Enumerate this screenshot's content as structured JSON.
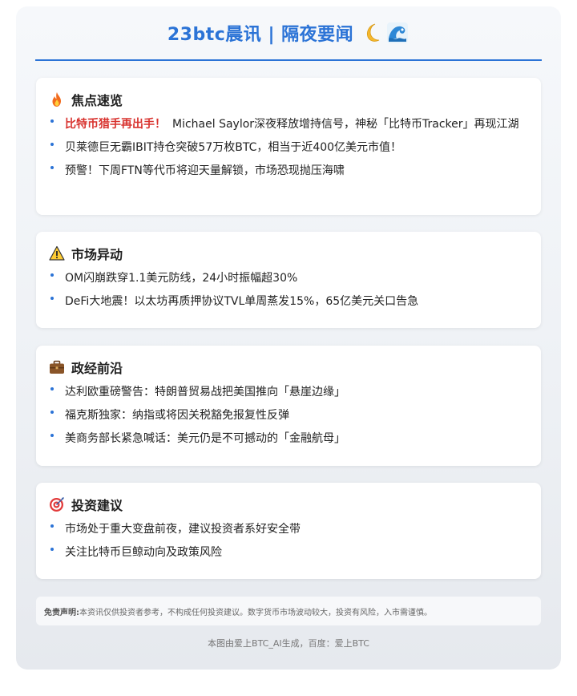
{
  "header": {
    "title": "23btc晨讯 | 隔夜要闻",
    "icons": [
      "crescent-moon-icon",
      "water-wave-icon"
    ]
  },
  "sections": [
    {
      "title": "焦点速览",
      "icon": "fire-icon",
      "items": [
        {
          "highlight": "比特币猎手再出手！",
          "text": "Michael Saylor深夜释放增持信号，神秘「比特币Tracker」再现江湖"
        },
        {
          "highlight": "",
          "text": "贝莱德巨无霸IBIT持仓突破57万枚BTC，相当于近400亿美元市值！"
        },
        {
          "highlight": "",
          "text": "预警！下周FTN等代币将迎天量解锁，市场恐现抛压海啸"
        }
      ]
    },
    {
      "title": "市场异动",
      "icon": "warning-icon",
      "items": [
        {
          "highlight": "",
          "text": "OM闪崩跌穿1.1美元防线，24小时振幅超30%"
        },
        {
          "highlight": "",
          "text": "DeFi大地震！以太坊再质押协议TVL单周蒸发15%，65亿美元关口告急"
        }
      ]
    },
    {
      "title": "政经前沿",
      "icon": "briefcase-icon",
      "items": [
        {
          "highlight": "",
          "text": "达利欧重磅警告：特朗普贸易战把美国推向「悬崖边缘」"
        },
        {
          "highlight": "",
          "text": "福克斯独家：纳指或将因关税豁免报复性反弹"
        },
        {
          "highlight": "",
          "text": "美商务部长紧急喊话：美元仍是不可撼动的「金融航母」"
        }
      ]
    },
    {
      "title": "投资建议",
      "icon": "target-icon",
      "items": [
        {
          "highlight": "",
          "text": "市场处于重大变盘前夜，建议投资者系好安全带"
        },
        {
          "highlight": "",
          "text": "关注比特币巨鲸动向及政策风险"
        }
      ]
    }
  ],
  "disclaimer": {
    "label": "免责声明:",
    "text": "本资讯仅供投资者参考，不构成任何投资建议。数字货币市场波动较大，投资有风险，入市需谨慎。"
  },
  "footer": {
    "text": "本图由爱上BTC_AI生成，百度：爱上BTC"
  },
  "colors": {
    "accent": "#2b73d6",
    "highlight": "#d8322e"
  }
}
